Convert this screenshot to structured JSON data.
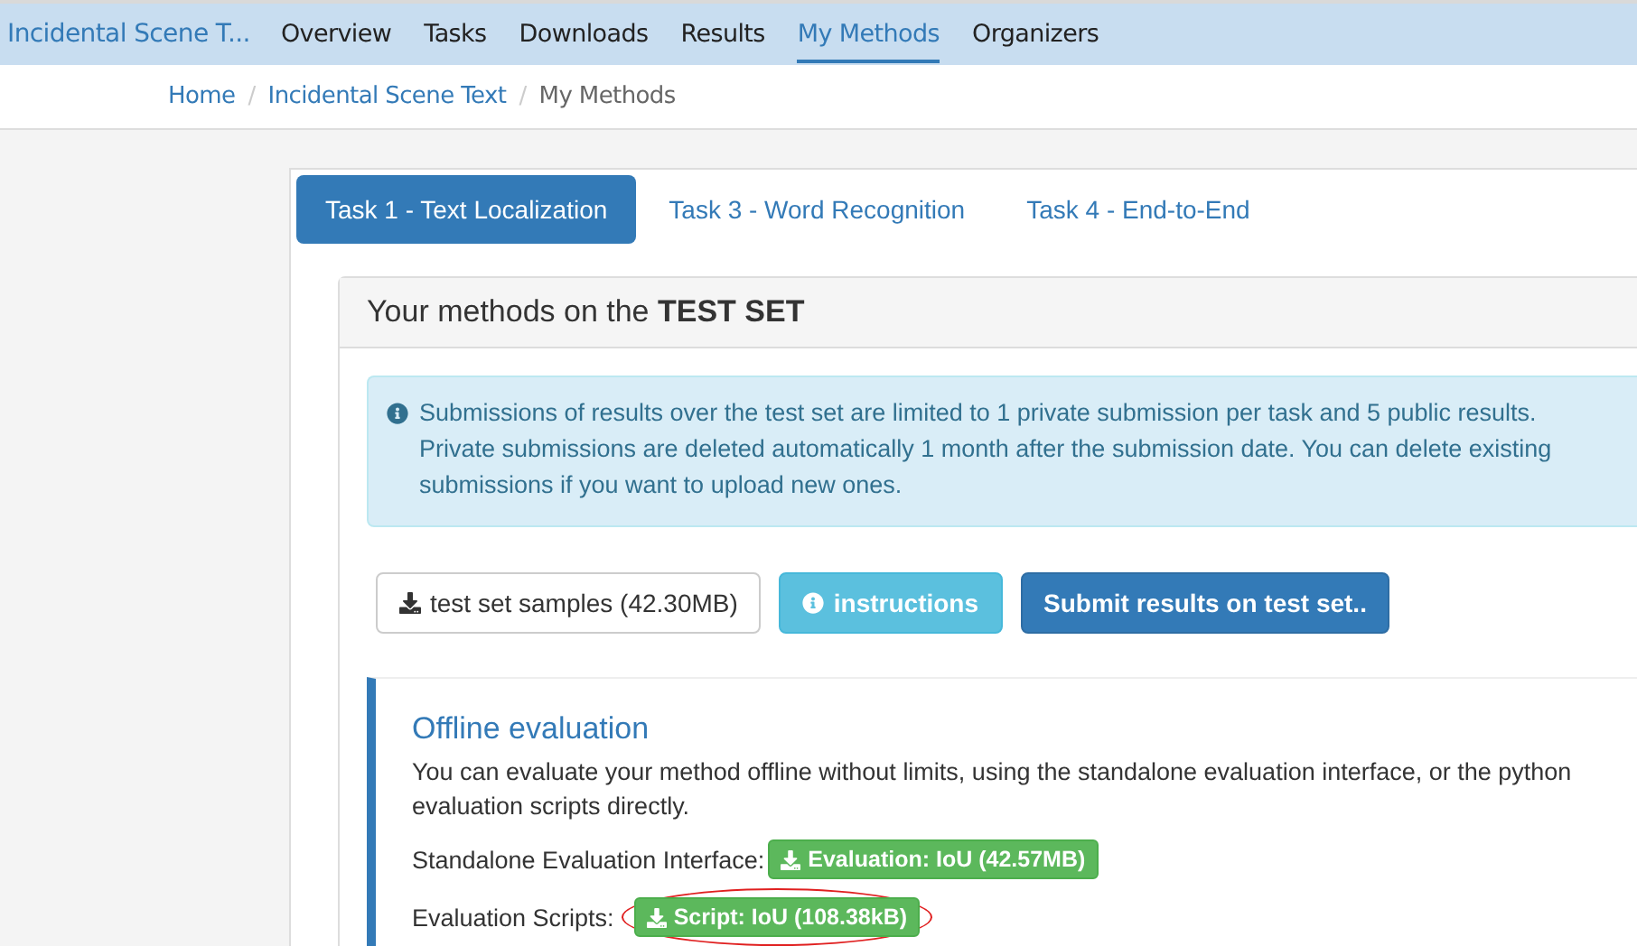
{
  "navbar": {
    "brand": "Incidental Scene T...",
    "items": [
      {
        "label": "Overview",
        "selected": false
      },
      {
        "label": "Tasks",
        "selected": false
      },
      {
        "label": "Downloads",
        "selected": false
      },
      {
        "label": "Results",
        "selected": false
      },
      {
        "label": "My Methods",
        "selected": true
      },
      {
        "label": "Organizers",
        "selected": false
      }
    ]
  },
  "breadcrumb_separator": "/",
  "breadcrumb": [
    {
      "label": "Home",
      "kind": "link"
    },
    {
      "label": "Incidental Scene Text",
      "kind": "link"
    },
    {
      "label": "My Methods",
      "kind": "current"
    }
  ],
  "tabs": [
    {
      "label": "Task 1 - Text Localization",
      "selected": true
    },
    {
      "label": "Task 3 - Word Recognition",
      "selected": false
    },
    {
      "label": "Task 4 - End-to-End",
      "selected": false
    }
  ],
  "panel": {
    "heading": "Your methods on the **TEST SET**",
    "alert": "Submissions of results over the test set are limited to 1 private submission per task and 5 public results. Private submissions are deleted automatically 1 month after the submission date. You can delete existing submissions if you want to upload new ones.",
    "buttons": [
      {
        "label": "test set samples (42.30MB)",
        "kind": "download"
      },
      {
        "label": "instructions",
        "kind": "info"
      },
      {
        "label": "Submit results on test set..",
        "kind": "primary"
      }
    ],
    "offline": {
      "title": "Offline evaluation",
      "description": "You can evaluate your method offline without limits, using the standalone evaluation interface, or the python evaluation scripts directly.",
      "rows": [
        {
          "label": "Standalone Evaluation Interface:",
          "button": "Evaluation: IoU (42.57MB)",
          "circled": false
        },
        {
          "label": "Evaluation Scripts:",
          "button": "Script: IoU (108.38kB)",
          "circled": true
        }
      ]
    }
  }
}
